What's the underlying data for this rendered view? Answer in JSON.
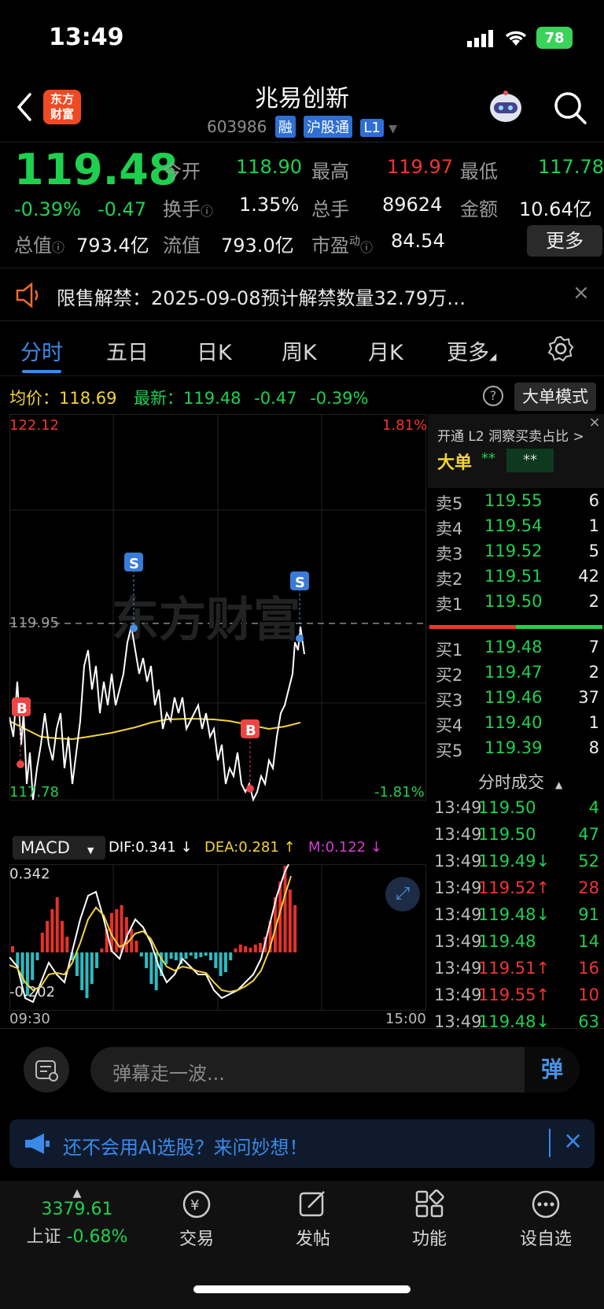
{
  "status_bar": {
    "time": "13:49",
    "battery": "78"
  },
  "header": {
    "title": "兆易创新",
    "code": "603986",
    "tags": [
      "融",
      "沪股通",
      "L1"
    ],
    "logo_text": "东方财富"
  },
  "quote": {
    "price": "119.48",
    "change_pct": "-0.39%",
    "change": "-0.47",
    "labels": {
      "open": "今开",
      "high": "最高",
      "low": "最低",
      "turnover": "换手",
      "volume": "总手",
      "amount": "金额",
      "mcap": "总值",
      "float_cap": "流值",
      "pe": "市盈",
      "pe_sup": "动"
    },
    "open": "118.90",
    "high": "119.97",
    "low": "117.78",
    "turnover": "1.35%",
    "volume": "89624",
    "amount": "10.64亿",
    "mcap": "793.4亿",
    "float_cap": "793.0亿",
    "pe": "84.54",
    "more_button": "更多"
  },
  "notice": {
    "text": "限售解禁：2025-09-08预计解禁数量32.79万…"
  },
  "tabs": [
    "分时",
    "五日",
    "日K",
    "周K",
    "月K",
    "更多"
  ],
  "info_line": {
    "avg_label": "均价：",
    "avg_value": "118.69",
    "latest_label": "最新：",
    "latest_value": "119.48",
    "change": "-0.47",
    "change_pct": "-0.39%",
    "mode_button": "大单模式"
  },
  "price_chart": {
    "top_price": "122.12",
    "bottom_price": "117.78",
    "top_pct": "1.81%",
    "bottom_pct": "-1.81%",
    "ref_price": "119.95",
    "watermark": "东方财富",
    "marker_buy": "B",
    "marker_sell": "S"
  },
  "macd": {
    "label": "MACD",
    "dif": "DIF:0.341 ↓",
    "dea": "DEA:0.281 ↑",
    "m": "M:0.122 ↓",
    "top": "0.342",
    "bottom": "-0.202",
    "start_time": "09:30",
    "end_time": "15:00"
  },
  "orderbook": {
    "l2_text": "开通 L2 洞察买卖占比 >",
    "big_label": "大单",
    "big_stars1": "**",
    "big_stars2": "**",
    "sells": [
      {
        "label": "卖5",
        "price": "119.55",
        "vol": "6"
      },
      {
        "label": "卖4",
        "price": "119.54",
        "vol": "1"
      },
      {
        "label": "卖3",
        "price": "119.52",
        "vol": "5"
      },
      {
        "label": "卖2",
        "price": "119.51",
        "vol": "42"
      },
      {
        "label": "卖1",
        "price": "119.50",
        "vol": "2"
      }
    ],
    "buys": [
      {
        "label": "买1",
        "price": "119.48",
        "vol": "7"
      },
      {
        "label": "买2",
        "price": "119.47",
        "vol": "2"
      },
      {
        "label": "买3",
        "price": "119.46",
        "vol": "37"
      },
      {
        "label": "买4",
        "price": "119.40",
        "vol": "1"
      },
      {
        "label": "买5",
        "price": "119.39",
        "vol": "8"
      }
    ],
    "trades_title": "分时成交",
    "trades": [
      {
        "time": "13:49",
        "price": "119.50",
        "arrow": "",
        "vol": "4",
        "color": "green"
      },
      {
        "time": "13:49",
        "price": "119.50",
        "arrow": "",
        "vol": "47",
        "color": "green"
      },
      {
        "time": "13:49",
        "price": "119.49",
        "arrow": "↓",
        "vol": "52",
        "color": "green"
      },
      {
        "time": "13:49",
        "price": "119.52",
        "arrow": "↑",
        "vol": "28",
        "color": "red"
      },
      {
        "time": "13:49",
        "price": "119.48",
        "arrow": "↓",
        "vol": "91",
        "color": "green"
      },
      {
        "time": "13:49",
        "price": "119.48",
        "arrow": "",
        "vol": "14",
        "color": "green"
      },
      {
        "time": "13:49",
        "price": "119.51",
        "arrow": "↑",
        "vol": "16",
        "color": "red"
      },
      {
        "time": "13:49",
        "price": "119.55",
        "arrow": "↑",
        "vol": "10",
        "color": "red"
      },
      {
        "time": "13:49",
        "price": "119.48",
        "arrow": "↓",
        "vol": "63",
        "color": "green"
      }
    ]
  },
  "comment": {
    "placeholder": "弹幕走一波...",
    "send": "弹"
  },
  "ai_banner": {
    "text": "还不会用AI选股？来问妙想！"
  },
  "bottom_nav": {
    "index_value": "3379.61",
    "index_name": "上证",
    "index_change": "-0.68%",
    "items": [
      "交易",
      "发帖",
      "功能",
      "设自选"
    ]
  },
  "colors": {
    "up": "#f0352f",
    "down": "#1fd04f",
    "avg_line": "#f2d33b",
    "accent": "#2f7bd9"
  }
}
